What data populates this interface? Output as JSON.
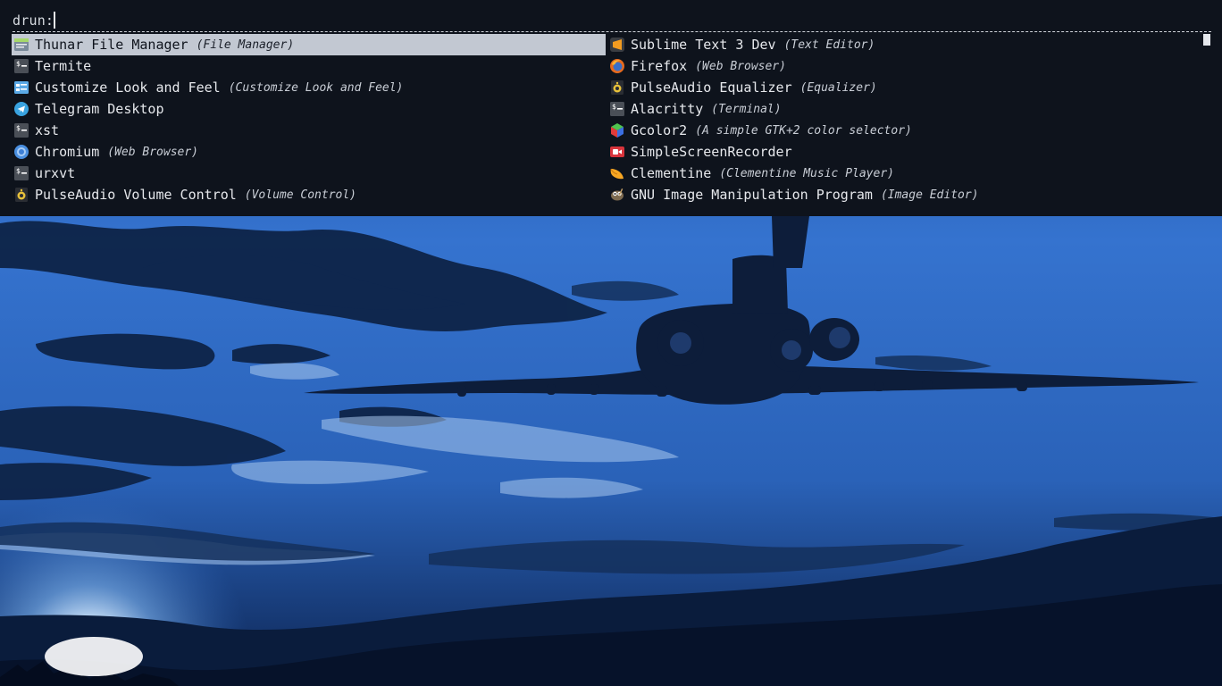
{
  "launcher": {
    "prompt_label": "drun:",
    "query": "",
    "left_entries": [
      {
        "name": "Thunar File Manager",
        "generic": "(File Manager)",
        "icon": "file-manager-icon",
        "selected": true
      },
      {
        "name": "Termite",
        "generic": "",
        "icon": "terminal-icon",
        "selected": false
      },
      {
        "name": "Customize Look and Feel",
        "generic": "(Customize Look and Feel)",
        "icon": "appearance-icon",
        "selected": false
      },
      {
        "name": "Telegram Desktop",
        "generic": "",
        "icon": "telegram-icon",
        "selected": false
      },
      {
        "name": "xst",
        "generic": "",
        "icon": "terminal-icon",
        "selected": false
      },
      {
        "name": "Chromium",
        "generic": "(Web Browser)",
        "icon": "chromium-icon",
        "selected": false
      },
      {
        "name": "urxvt",
        "generic": "",
        "icon": "terminal-icon",
        "selected": false
      },
      {
        "name": "PulseAudio Volume Control",
        "generic": "(Volume Control)",
        "icon": "speaker-icon",
        "selected": false
      }
    ],
    "right_entries": [
      {
        "name": "Sublime Text 3 Dev",
        "generic": "(Text Editor)",
        "icon": "sublime-icon",
        "selected": false
      },
      {
        "name": "Firefox",
        "generic": "(Web Browser)",
        "icon": "firefox-icon",
        "selected": false
      },
      {
        "name": "PulseAudio Equalizer",
        "generic": "(Equalizer)",
        "icon": "speaker-icon",
        "selected": false
      },
      {
        "name": "Alacritty",
        "generic": "(Terminal)",
        "icon": "terminal-icon",
        "selected": false
      },
      {
        "name": "Gcolor2",
        "generic": "(A simple GTK+2 color selector)",
        "icon": "color-cube-icon",
        "selected": false
      },
      {
        "name": "SimpleScreenRecorder",
        "generic": "",
        "icon": "screen-recorder-icon",
        "selected": false
      },
      {
        "name": "Clementine",
        "generic": "(Clementine Music Player)",
        "icon": "clementine-icon",
        "selected": false
      },
      {
        "name": "GNU Image Manipulation Program",
        "generic": "(Image Editor)",
        "icon": "gimp-icon",
        "selected": false
      }
    ]
  },
  "colors": {
    "launcher_bg": "#0e131c",
    "selection_bg": "#c2c8d2",
    "text": "#e6e8ec",
    "sky": "#2f6bc4"
  }
}
